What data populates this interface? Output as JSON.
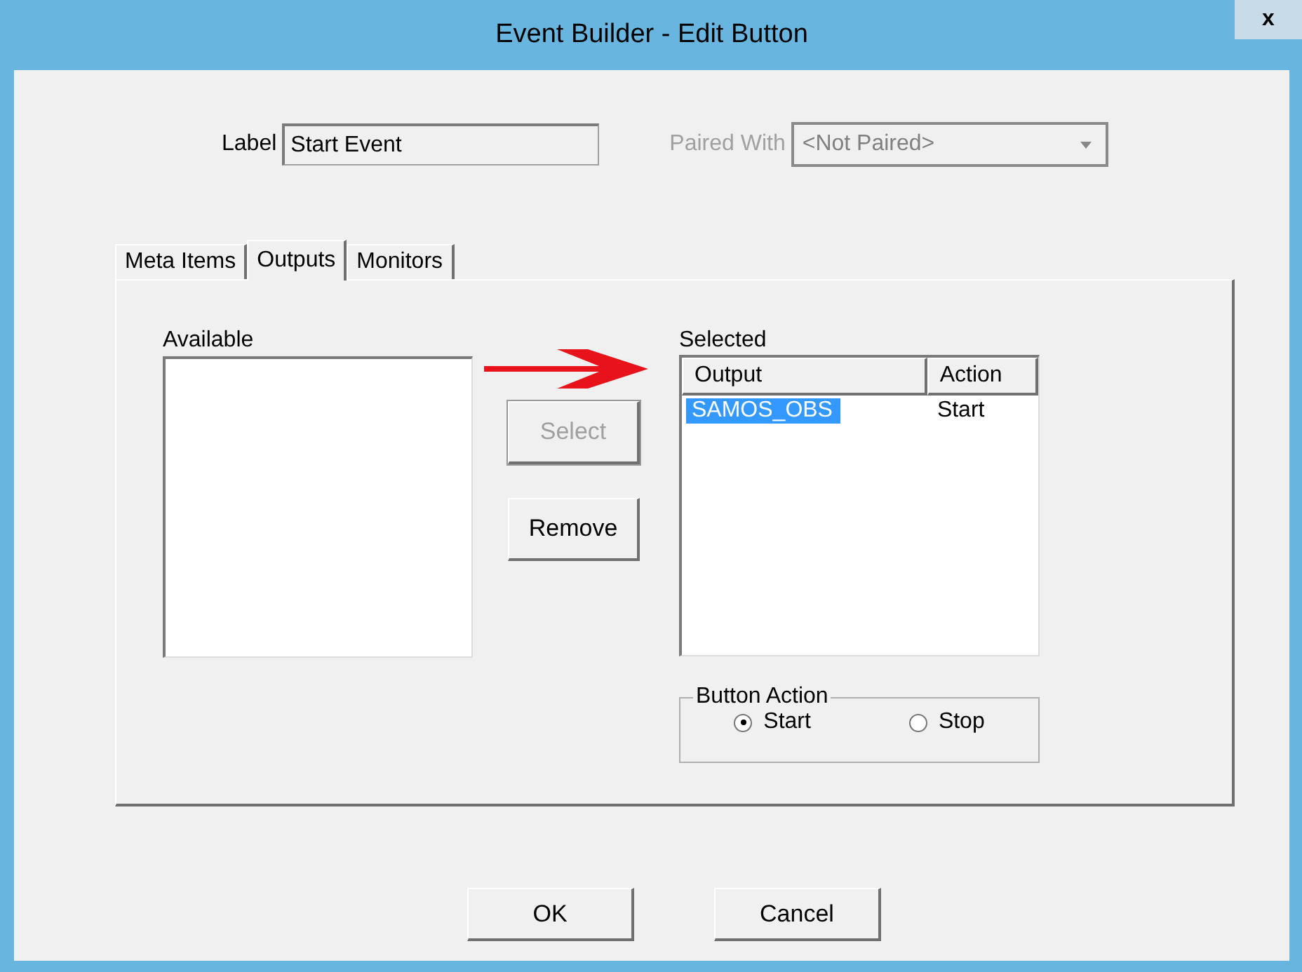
{
  "window": {
    "title": "Event Builder - Edit Button",
    "close_glyph": "x"
  },
  "label_field": {
    "label": "Label",
    "value": "Start Event"
  },
  "paired_with": {
    "label": "Paired With",
    "value": "<Not Paired>",
    "disabled": true
  },
  "tabs": [
    {
      "label": "Meta Items",
      "selected": false
    },
    {
      "label": "Outputs",
      "selected": true
    },
    {
      "label": "Monitors",
      "selected": false
    }
  ],
  "available": {
    "label": "Available"
  },
  "buttons_mid": [
    {
      "label": "Select",
      "disabled": true
    },
    {
      "label": "Remove",
      "disabled": false
    }
  ],
  "selected_list": {
    "label": "Selected",
    "columns": [
      "Output",
      "Action"
    ],
    "rows": [
      {
        "cells": [
          "SAMOS_OBS",
          "Start"
        ],
        "selected": true
      }
    ]
  },
  "button_action": {
    "title": "Button Action",
    "options": [
      {
        "label": "Start",
        "selected": true
      },
      {
        "label": "Stop",
        "selected": false
      }
    ]
  },
  "buttons": [
    "OK",
    "Cancel"
  ]
}
